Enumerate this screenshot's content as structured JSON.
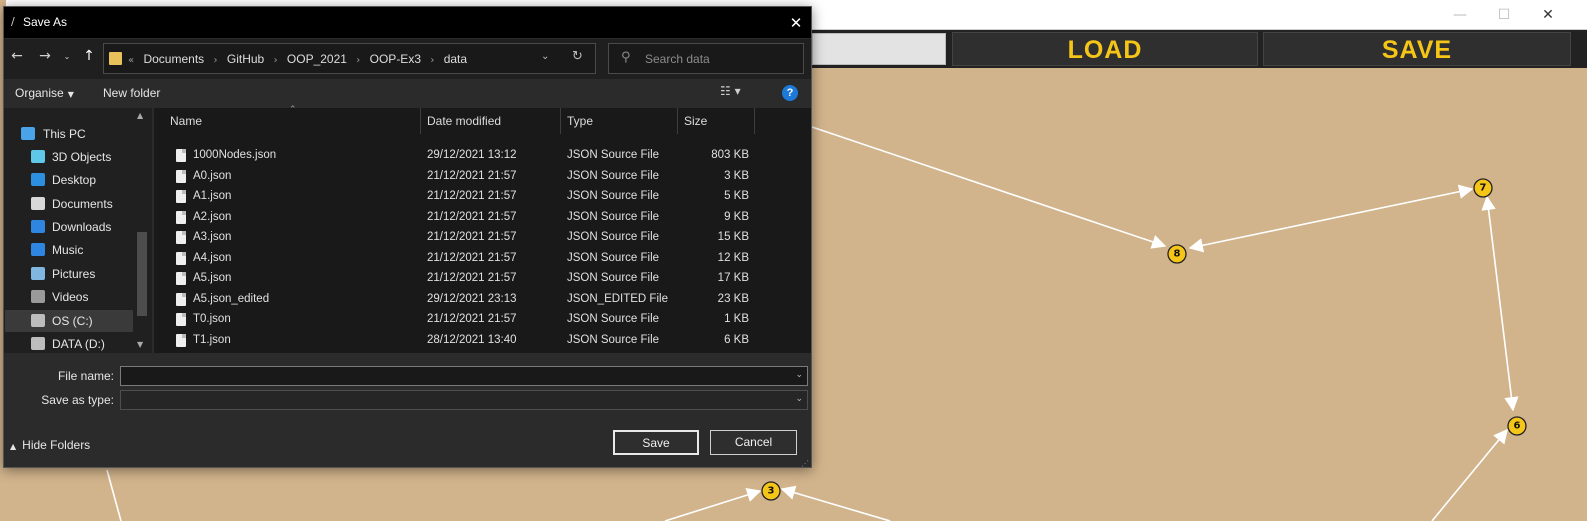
{
  "app": {
    "window_controls": {
      "minimize": "—",
      "maximize": "☐",
      "close": "✕"
    },
    "buttons": {
      "load": "LOAD",
      "save": "SAVE"
    },
    "accent_color": "#f5c518",
    "canvas_color": "#d2b48c",
    "graph_nodes": [
      {
        "id": "8",
        "label": "8"
      },
      {
        "id": "7",
        "label": "7"
      },
      {
        "id": "6",
        "label": "6"
      },
      {
        "id": "3",
        "label": "3"
      }
    ]
  },
  "dialog": {
    "title": "Save As",
    "close_glyph": "✕",
    "nav": {
      "back": "←",
      "forward": "→",
      "recent": "⌄",
      "up": "↑"
    },
    "address": {
      "overflow": "«",
      "crumbs": [
        "Documents",
        "GitHub",
        "OOP_2021",
        "OOP-Ex3",
        "data"
      ],
      "separator": "›"
    },
    "search": {
      "placeholder": "Search data"
    },
    "toolbar": {
      "organise": "Organise",
      "new_folder": "New folder",
      "help": "?"
    },
    "nav_pane": {
      "items": [
        {
          "label": "This PC",
          "icon": "computer-icon",
          "color": "#4aa3e8"
        },
        {
          "label": "3D Objects",
          "icon": "cube-icon",
          "color": "#5fc7e8"
        },
        {
          "label": "Desktop",
          "icon": "desktop-icon",
          "color": "#2d8fe0"
        },
        {
          "label": "Documents",
          "icon": "document-icon",
          "color": "#d8d8d8"
        },
        {
          "label": "Downloads",
          "icon": "download-icon",
          "color": "#2f86e0"
        },
        {
          "label": "Music",
          "icon": "music-icon",
          "color": "#2f86e0"
        },
        {
          "label": "Pictures",
          "icon": "pictures-icon",
          "color": "#7fb7e0"
        },
        {
          "label": "Videos",
          "icon": "videos-icon",
          "color": "#9a9a9a"
        },
        {
          "label": "OS (C:)",
          "icon": "drive-icon",
          "color": "#bdbdbd"
        },
        {
          "label": "DATA (D:)",
          "icon": "drive-icon",
          "color": "#bdbdbd"
        }
      ],
      "selected_index": 8
    },
    "columns": {
      "name": "Name",
      "date": "Date modified",
      "type": "Type",
      "size": "Size"
    },
    "files": [
      {
        "name": "1000Nodes.json",
        "date": "29/12/2021 13:12",
        "type": "JSON Source File",
        "size": "803 KB"
      },
      {
        "name": "A0.json",
        "date": "21/12/2021 21:57",
        "type": "JSON Source File",
        "size": "3 KB"
      },
      {
        "name": "A1.json",
        "date": "21/12/2021 21:57",
        "type": "JSON Source File",
        "size": "5 KB"
      },
      {
        "name": "A2.json",
        "date": "21/12/2021 21:57",
        "type": "JSON Source File",
        "size": "9 KB"
      },
      {
        "name": "A3.json",
        "date": "21/12/2021 21:57",
        "type": "JSON Source File",
        "size": "15 KB"
      },
      {
        "name": "A4.json",
        "date": "21/12/2021 21:57",
        "type": "JSON Source File",
        "size": "12 KB"
      },
      {
        "name": "A5.json",
        "date": "21/12/2021 21:57",
        "type": "JSON Source File",
        "size": "17 KB"
      },
      {
        "name": "A5.json_edited",
        "date": "29/12/2021 23:13",
        "type": "JSON_EDITED File",
        "size": "23 KB"
      },
      {
        "name": "T0.json",
        "date": "21/12/2021 21:57",
        "type": "JSON Source File",
        "size": "1 KB"
      },
      {
        "name": "T1.json",
        "date": "28/12/2021 13:40",
        "type": "JSON Source File",
        "size": "6 KB"
      }
    ],
    "form": {
      "file_name_label": "File name:",
      "file_name_value": "",
      "save_type_label": "Save as type:",
      "save_type_value": ""
    },
    "hide_folders": "Hide Folders",
    "buttons": {
      "save": "Save",
      "cancel": "Cancel"
    }
  }
}
